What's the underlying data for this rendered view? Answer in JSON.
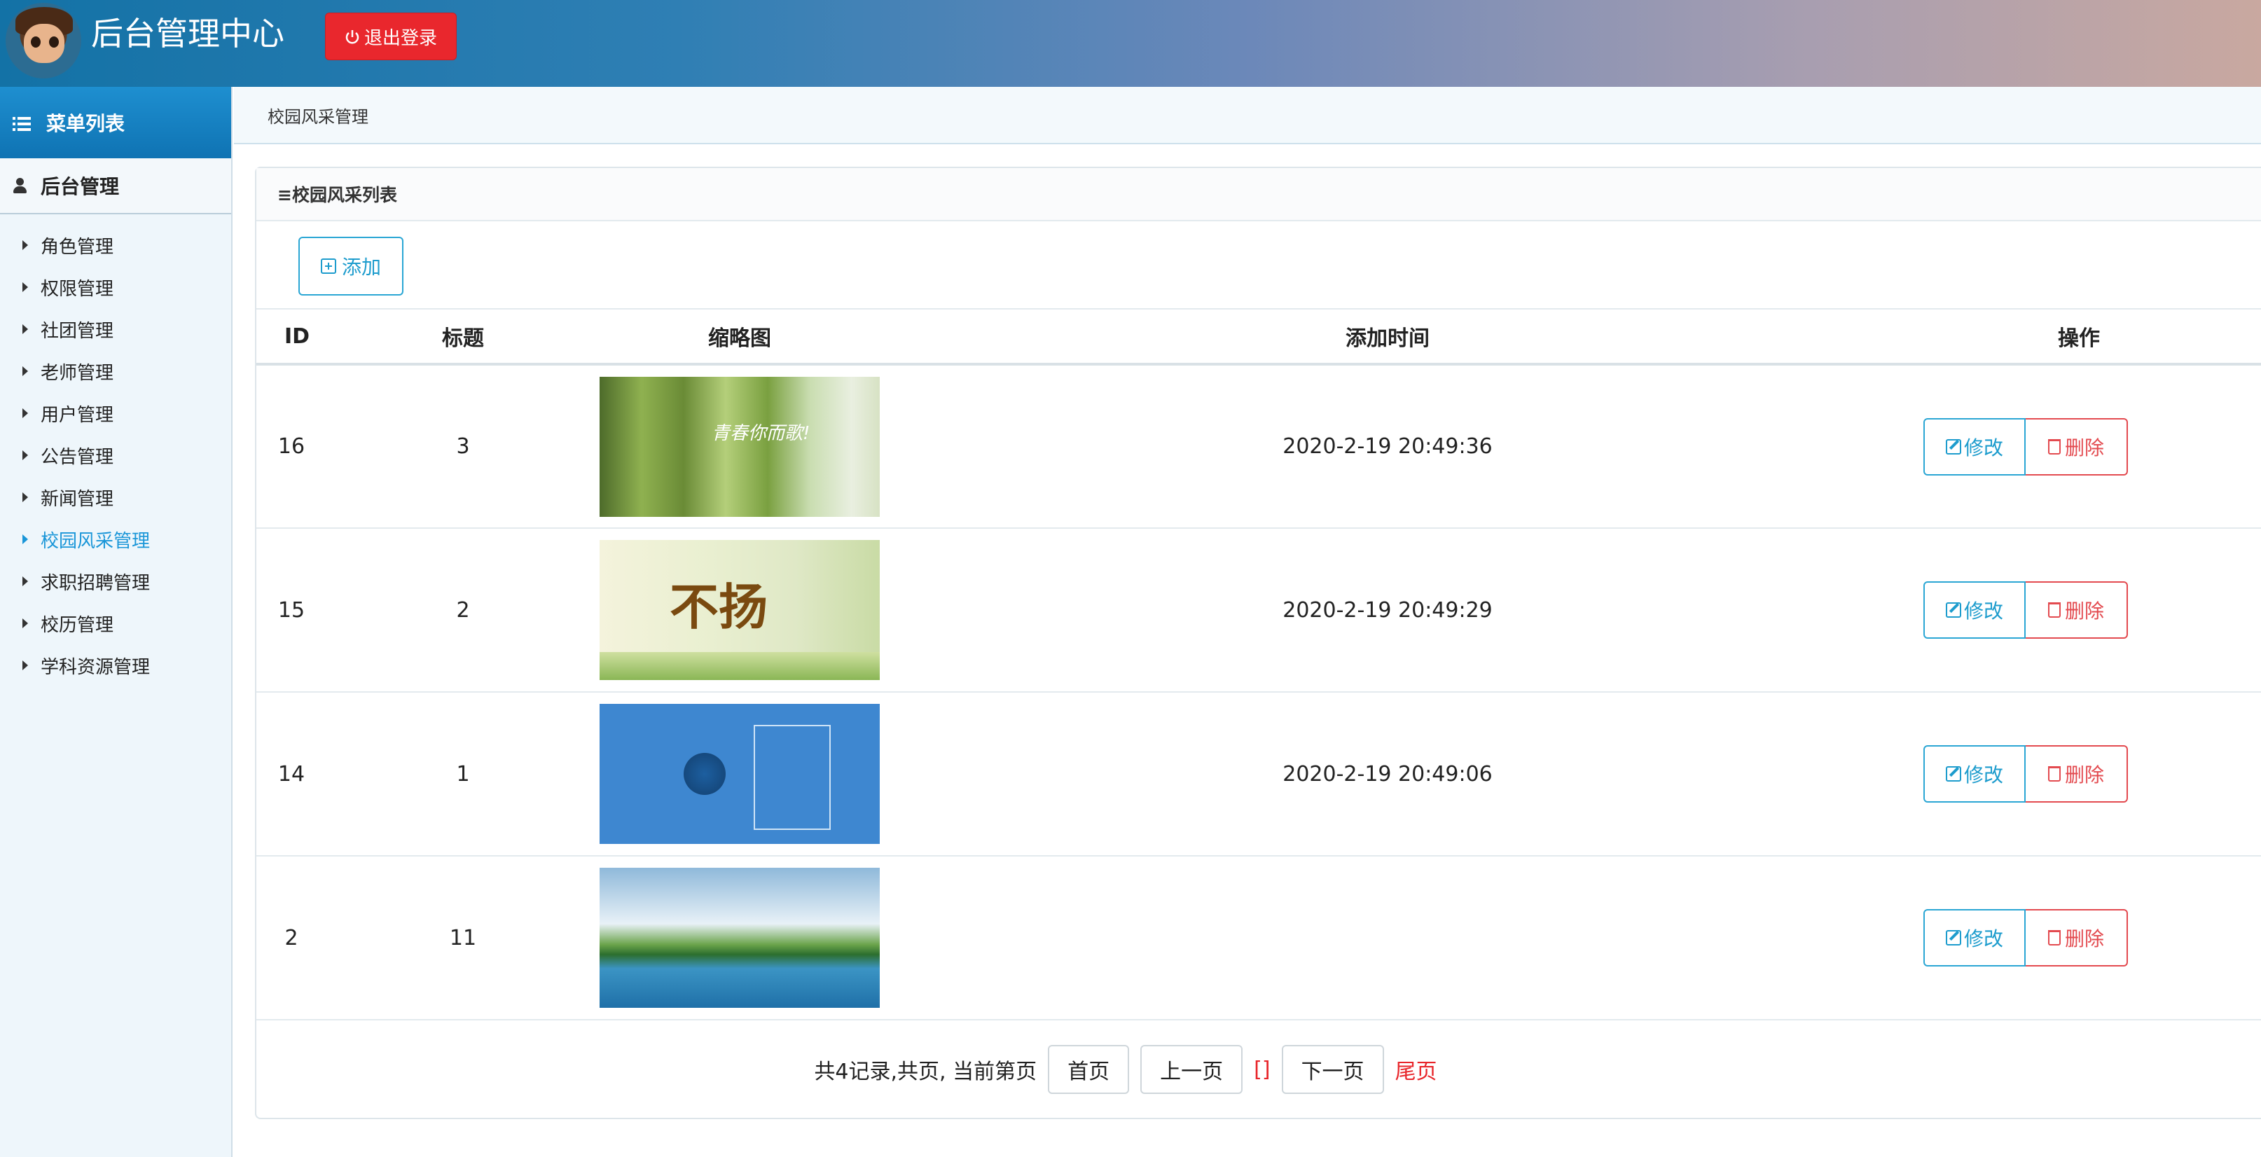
{
  "header": {
    "title": "后台管理中心",
    "logout_label": "退出登录"
  },
  "sidebar": {
    "menu_title": "菜单列表",
    "section_title": "后台管理",
    "items": [
      {
        "label": "角色管理"
      },
      {
        "label": "权限管理"
      },
      {
        "label": "社团管理"
      },
      {
        "label": "老师管理"
      },
      {
        "label": "用户管理"
      },
      {
        "label": "公告管理"
      },
      {
        "label": "新闻管理"
      },
      {
        "label": "校园风采管理"
      },
      {
        "label": "求职招聘管理"
      },
      {
        "label": "校历管理"
      },
      {
        "label": "学科资源管理"
      }
    ],
    "active_item": "校园风采管理"
  },
  "breadcrumb": "校园风采管理",
  "panel": {
    "title": "≡校园风采列表",
    "add_label": "添加",
    "columns": [
      "ID",
      "标题",
      "缩略图",
      "添加时间",
      "操作"
    ],
    "rows": [
      {
        "id": "16",
        "title": "3",
        "time": "2020-2-19 20:49:36",
        "thumb_text": "青春你而歌!"
      },
      {
        "id": "15",
        "title": "2",
        "time": "2020-2-19 20:49:29",
        "thumb_text": "不扬"
      },
      {
        "id": "14",
        "title": "1",
        "time": "2020-2-19 20:49:06",
        "thumb_text": ""
      },
      {
        "id": "2",
        "title": "11",
        "time": "",
        "thumb_text": ""
      }
    ],
    "edit_label": "修改",
    "delete_label": "删除"
  },
  "pager": {
    "summary": "共4记录,共页, 当前第页",
    "first": "首页",
    "prev": "上一页",
    "current": "[]",
    "next": "下一页",
    "last": "尾页"
  },
  "colors": {
    "accent": "#1d9ccd",
    "danger": "#e34a4f",
    "logout": "#e9272d"
  }
}
